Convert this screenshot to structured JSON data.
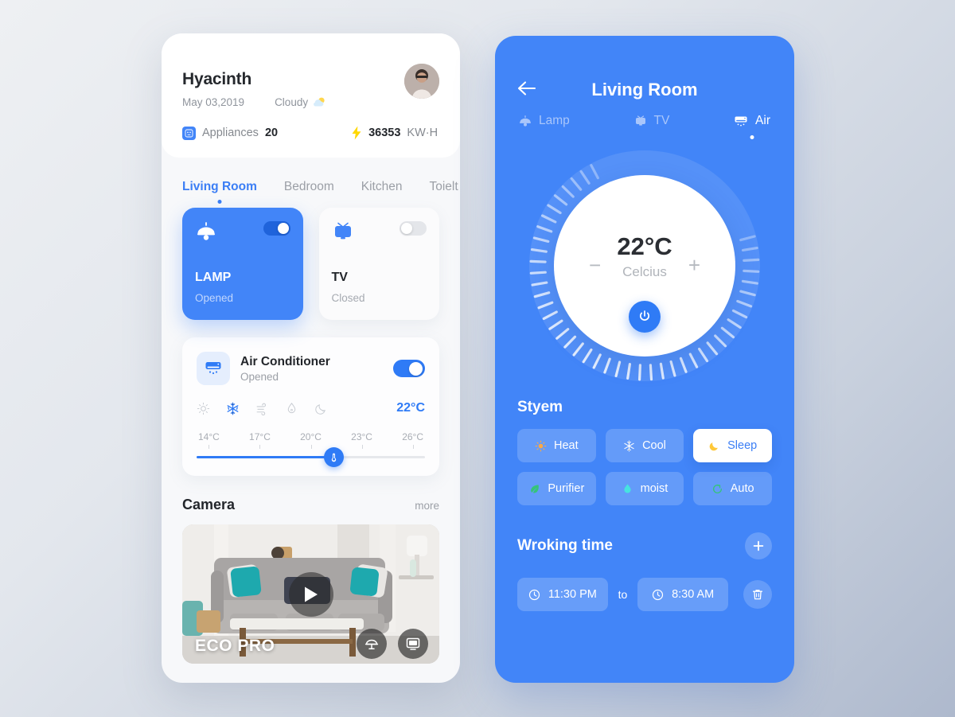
{
  "colors": {
    "accent": "#4285f8",
    "accent_dark": "#2f7bf6",
    "text_dark": "#23262b",
    "text_muted": "#9b9fa6",
    "bg_from": "#eef0f3",
    "bg_to": "#aeb9cd"
  },
  "home": {
    "user_name": "Hyacinth",
    "date": "May 03,2019",
    "weather": "Cloudy",
    "weather_icon": "partly-cloudy-icon",
    "appliances_label": "Appliances",
    "appliances_count": "20",
    "energy_value": "36353",
    "energy_unit": "KW·H",
    "energy_icon": "bolt-icon",
    "avatar": "user-avatar",
    "room_tabs": [
      {
        "label": "Living Room",
        "active": true
      },
      {
        "label": "Bedroom",
        "active": false
      },
      {
        "label": "Kitchen",
        "active": false
      },
      {
        "label": "Toielt",
        "active": false
      }
    ],
    "devices": [
      {
        "name": "LAMP",
        "state": "Opened",
        "icon": "lamp-icon",
        "on": true
      },
      {
        "name": "TV",
        "state": "Closed",
        "icon": "tv-icon",
        "on": false
      }
    ],
    "ac": {
      "title": "Air Conditioner",
      "state": "Opened",
      "icon": "air-conditioner-icon",
      "toggle_on": true,
      "modes": [
        {
          "name": "sun-icon",
          "active": false
        },
        {
          "name": "snowflake-icon",
          "active": true
        },
        {
          "name": "wind-icon",
          "active": false
        },
        {
          "name": "humidity-icon",
          "active": false
        },
        {
          "name": "moon-icon",
          "active": false
        }
      ],
      "current_temp": "22°C",
      "scale": [
        "14°C",
        "17°C",
        "20°C",
        "23°C",
        "26°C"
      ],
      "slider_percent": 60,
      "thumb_icon": "thermometer-icon"
    },
    "camera": {
      "title": "Camera",
      "more_label": "more",
      "stream_label": "ECO PRO",
      "play_icon": "play-icon",
      "buttons": [
        {
          "name": "lamp-control-icon"
        },
        {
          "name": "tv-control-icon"
        }
      ]
    }
  },
  "detail": {
    "back_icon": "back-arrow-icon",
    "title": "Living Room",
    "tabs": [
      {
        "label": "Lamp",
        "icon": "lamp-icon",
        "active": false
      },
      {
        "label": "TV",
        "icon": "tv-icon",
        "active": false
      },
      {
        "label": "Air",
        "icon": "air-conditioner-icon",
        "active": true
      }
    ],
    "dial": {
      "temperature": "22°C",
      "unit": "Celcius",
      "minus_label": "−",
      "plus_label": "+",
      "power_icon": "power-icon",
      "ticks": 44
    },
    "system": {
      "title": "Styem",
      "modes": [
        {
          "label": "Heat",
          "icon": "sun-icon",
          "color": "#ffa944",
          "active": false
        },
        {
          "label": "Cool",
          "icon": "snowflake-icon",
          "color": "#ffffff",
          "active": false
        },
        {
          "label": "Sleep",
          "icon": "moon-icon",
          "color": "#ffc839",
          "active": true
        },
        {
          "label": "Purifier",
          "icon": "leaf-icon",
          "color": "#35c47a",
          "active": false
        },
        {
          "label": "moist",
          "icon": "droplet-icon",
          "color": "#46e3e0",
          "active": false
        },
        {
          "label": "Auto",
          "icon": "auto-refresh-icon",
          "color": "#35c47a",
          "active": false
        }
      ]
    },
    "working_time": {
      "title": "Wroking time",
      "add_icon": "plus-icon",
      "start": "11:30 PM",
      "separator": "to",
      "end": "8:30 AM",
      "clock_icon": "clock-icon",
      "delete_icon": "trash-icon"
    }
  }
}
